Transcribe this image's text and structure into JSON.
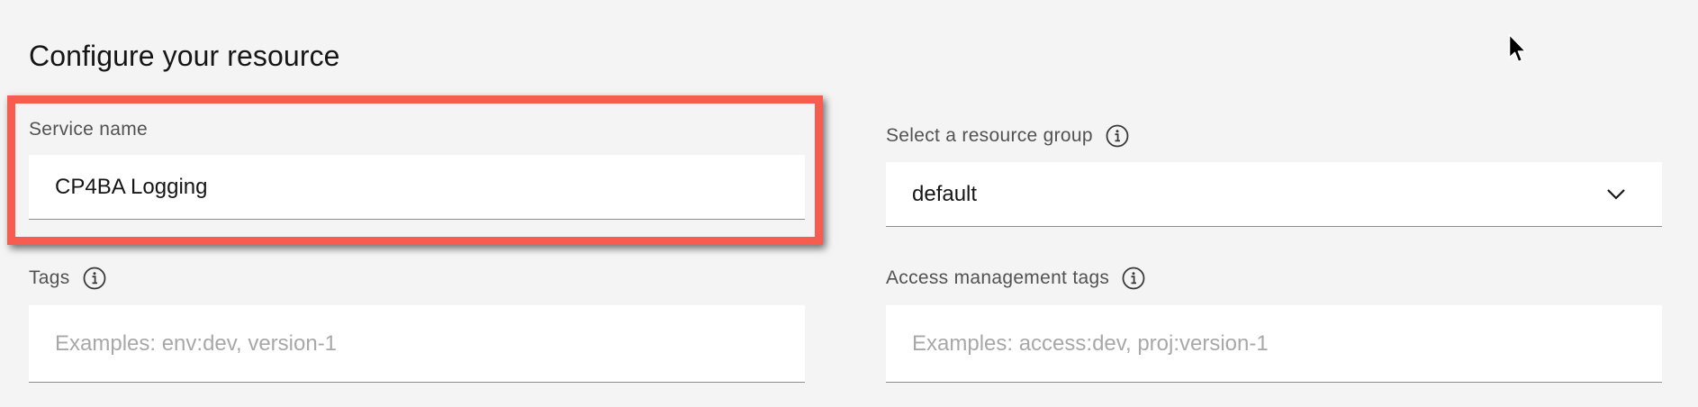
{
  "section": {
    "title": "Configure your resource"
  },
  "service_name": {
    "label": "Service name",
    "value": "CP4BA Logging"
  },
  "resource_group": {
    "label": "Select a resource group",
    "selected": "default"
  },
  "tags": {
    "label": "Tags",
    "placeholder": "Examples: env:dev, version-1"
  },
  "access_tags": {
    "label": "Access management tags",
    "placeholder": "Examples: access:dev, proj:version-1"
  },
  "icons": {
    "info": "info-icon",
    "chevron": "chevron-down-icon",
    "cursor": "mouse-pointer-icon"
  },
  "colors": {
    "highlight": "#f75c50",
    "background": "#f4f4f4",
    "field_bg": "#ffffff"
  }
}
